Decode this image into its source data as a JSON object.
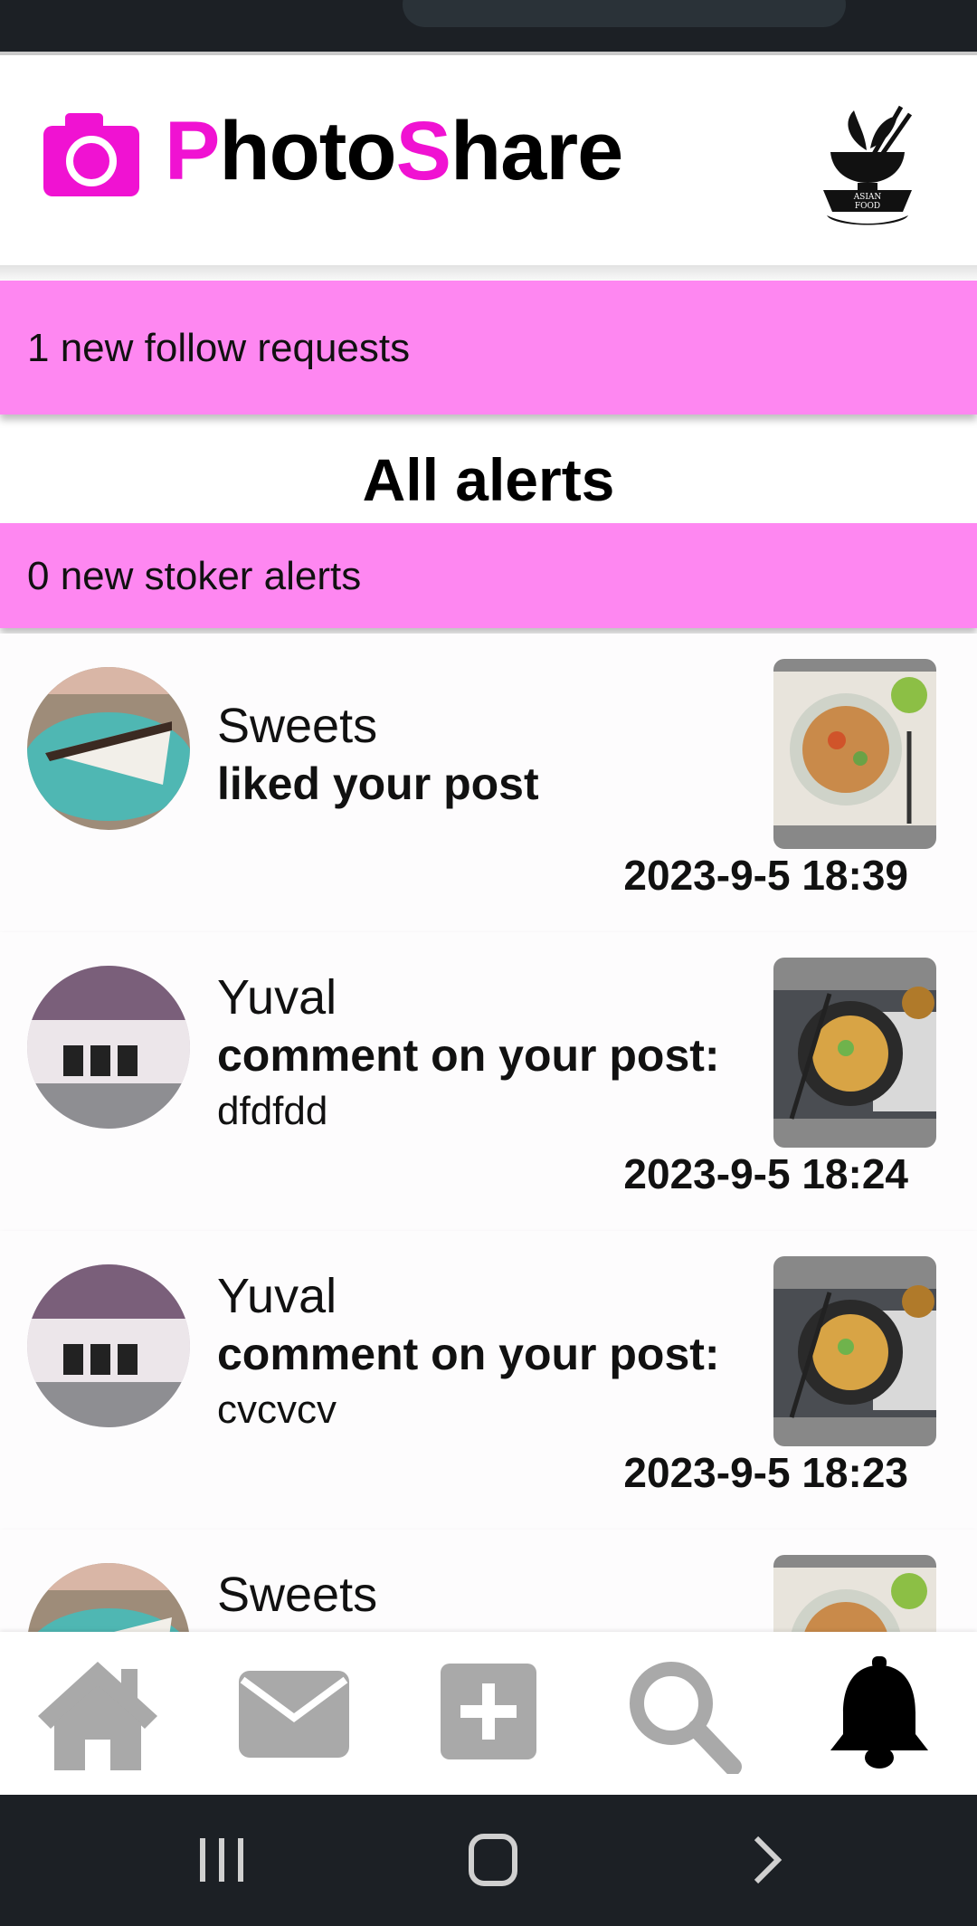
{
  "app": {
    "brand_first": "P",
    "brand_part2": "hoto",
    "brand_accent2": "S",
    "brand_part4": "hare",
    "logo_text": "ASIAN FOOD",
    "accent_color": "#f012d2",
    "banner_color": "#fe87f1"
  },
  "follow_banner": {
    "text": "1 new follow requests"
  },
  "alerts_title": "All alerts",
  "stoker_banner": {
    "text": "0 new stoker alerts"
  },
  "alerts": [
    {
      "user": "Sweets",
      "action": "liked your post",
      "comment": "",
      "time": "2023-9-5 18:39",
      "avatar": "pie-slice",
      "thumb": "noodle-plate"
    },
    {
      "user": "Yuval",
      "action": "comment on your post:",
      "comment": "dfdfdd",
      "time": "2023-9-5 18:24",
      "avatar": "plant-shelf",
      "thumb": "noodle-bowl"
    },
    {
      "user": "Yuval",
      "action": "comment on your post:",
      "comment": "cvcvcv",
      "time": "2023-9-5 18:23",
      "avatar": "plant-shelf",
      "thumb": "noodle-bowl"
    },
    {
      "user": "Sweets",
      "action": "",
      "comment": "",
      "time": "",
      "avatar": "pie-slice",
      "thumb": "noodle-plate"
    }
  ],
  "bottom_nav": [
    {
      "name": "home-icon",
      "active": false
    },
    {
      "name": "mail-icon",
      "active": false
    },
    {
      "name": "add-post-icon",
      "active": false
    },
    {
      "name": "search-icon",
      "active": false
    },
    {
      "name": "bell-icon",
      "active": true
    }
  ],
  "system_nav": [
    "recents-icon",
    "home-circle-icon",
    "back-arrow-icon"
  ]
}
